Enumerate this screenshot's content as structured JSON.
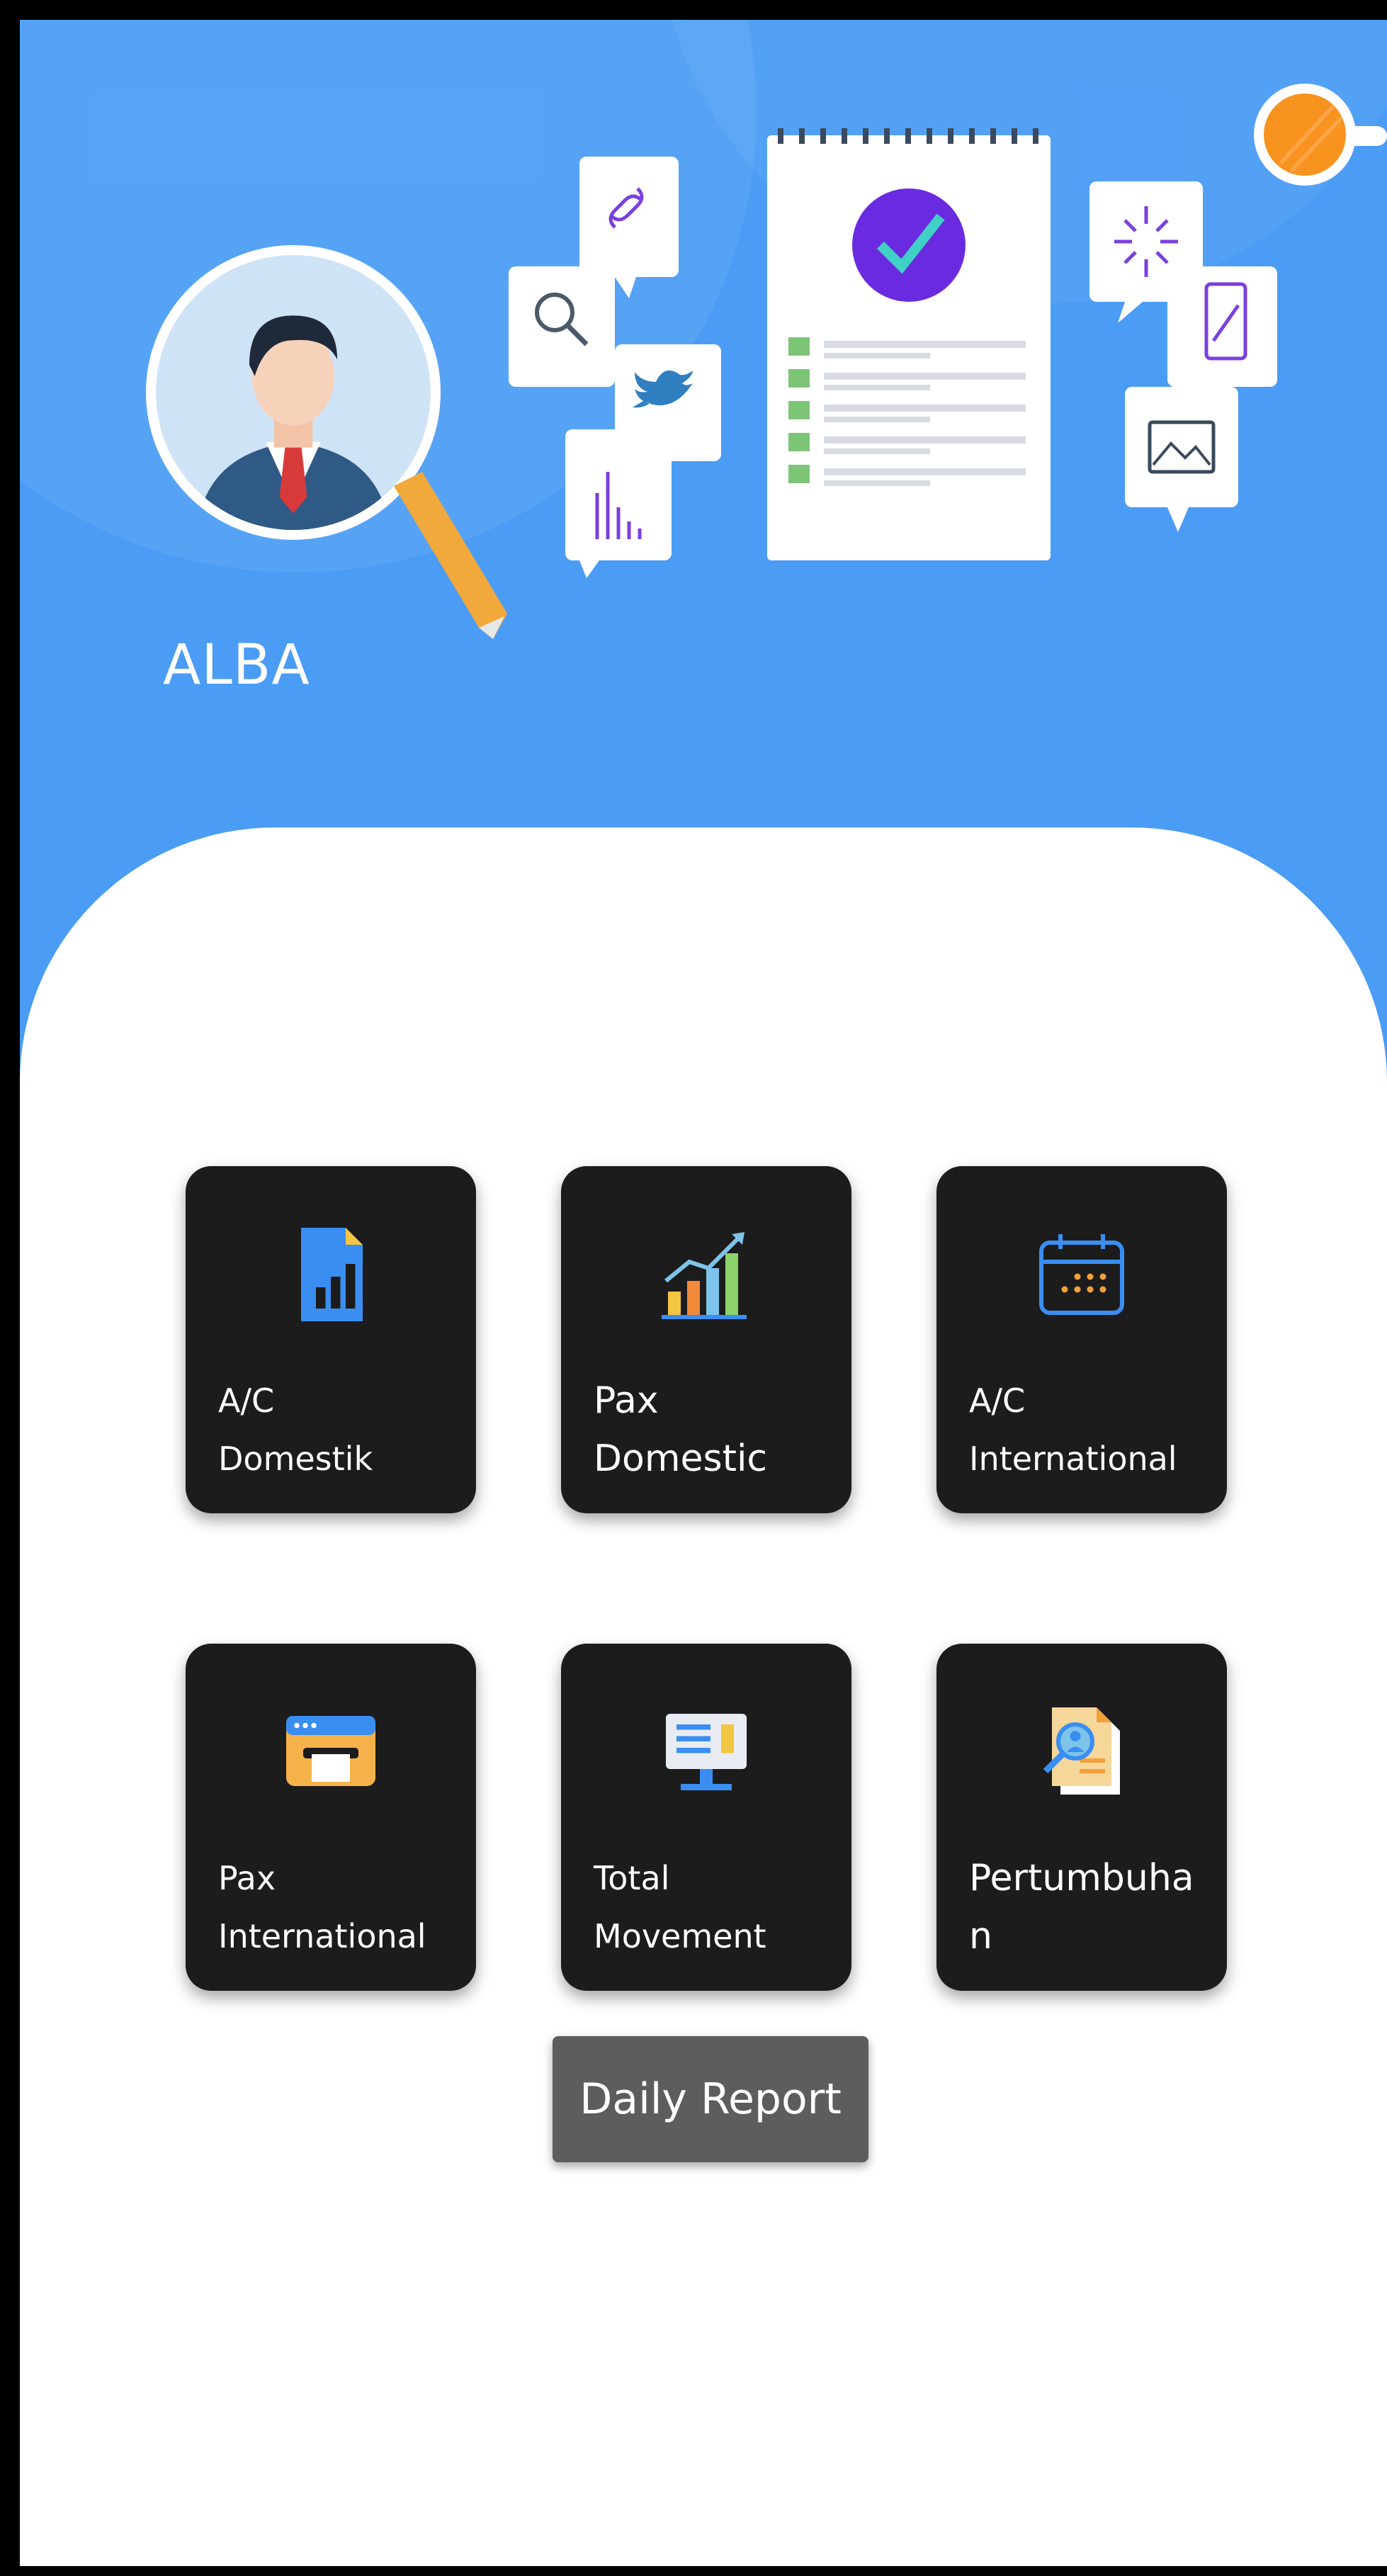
{
  "profile": {
    "name": "ALBA"
  },
  "colors": {
    "header_bg": "#4a9cf5",
    "tile_bg": "#1c1c1c",
    "button_bg": "#5d5d5d",
    "toggle_orange": "#f7931e"
  },
  "icons": {
    "theme_toggle": "theme-toggle-icon",
    "avatar": "businessman-avatar",
    "illustration": "report-checklist-illustration"
  },
  "menu": [
    {
      "label": "A/C\nDomestik",
      "icon": "document-chart-icon"
    },
    {
      "label": "Pax\nDomestic",
      "icon": "growth-chart-icon"
    },
    {
      "label": "A/C\nInternational",
      "icon": "calendar-icon"
    },
    {
      "label": "Pax\nInternational",
      "icon": "printer-icon"
    },
    {
      "label": "Total\nMovement",
      "icon": "monitor-icon"
    },
    {
      "label": "Pertumbuhan",
      "icon": "search-report-icon"
    }
  ],
  "actions": {
    "daily_report_label": "Daily Report"
  }
}
